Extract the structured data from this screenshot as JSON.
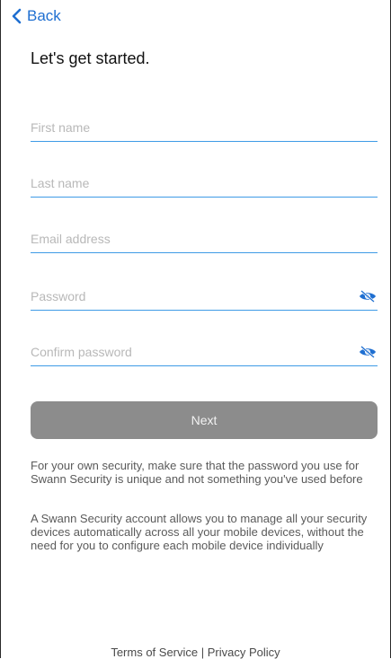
{
  "nav": {
    "back_label": "Back"
  },
  "header": {
    "title": "Let's get started."
  },
  "form": {
    "first_name_placeholder": "First name",
    "last_name_placeholder": "Last name",
    "email_placeholder": "Email address",
    "password_placeholder": "Password",
    "confirm_password_placeholder": "Confirm password",
    "next_label": "Next"
  },
  "notes": {
    "security": "For your own security, make sure that the password you use for Swann Security is unique and not something you've used before",
    "account": "A Swann Security account allows you to manage all your security devices automatically across all your mobile devices, without the need for you to configure each mobile device individually"
  },
  "footer": {
    "terms_label": "Terms of Service",
    "separator": " | ",
    "privacy_label": "Privacy Policy"
  },
  "colors": {
    "accent": "#1f6fd1",
    "field_underline": "#3e9be6",
    "button_disabled": "#8c8c8c"
  },
  "icons": {
    "back": "chevron-left-icon",
    "password_visibility": "eye-slash-icon"
  }
}
